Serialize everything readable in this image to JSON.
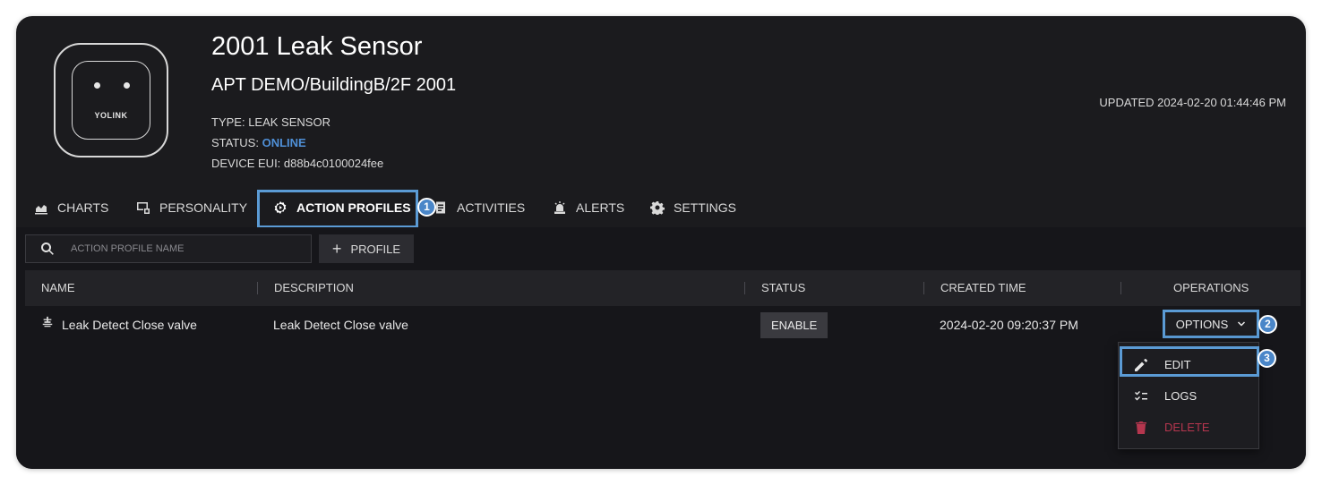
{
  "device": {
    "brand": "YOLINK",
    "title": "2001 Leak Sensor",
    "location": "APT DEMO/BuildingB/2F 2001",
    "type_label": "TYPE:",
    "type_value": "LEAK SENSOR",
    "status_label": "STATUS:",
    "status_value": "ONLINE",
    "eui_label": "DEVICE EUI:",
    "eui_value": "d88b4c0100024fee",
    "updated": "UPDATED 2024-02-20 01:44:46 PM"
  },
  "tabs": [
    {
      "label": "CHARTS",
      "icon": "chart-icon"
    },
    {
      "label": "PERSONALITY",
      "icon": "personality-icon"
    },
    {
      "label": "ACTION PROFILES",
      "icon": "action-profiles-icon",
      "active": true
    },
    {
      "label": "ACTIVITIES",
      "icon": "activities-icon"
    },
    {
      "label": "ALERTS",
      "icon": "alarm-icon"
    },
    {
      "label": "SETTINGS",
      "icon": "gear-icon"
    }
  ],
  "callouts": [
    "1",
    "2",
    "3"
  ],
  "search": {
    "placeholder": "ACTION PROFILE NAME"
  },
  "add_button": {
    "label": "PROFILE"
  },
  "table": {
    "headers": [
      "NAME",
      "DESCRIPTION",
      "STATUS",
      "CREATED TIME",
      "OPERATIONS"
    ],
    "rows": [
      {
        "name": "Leak Detect Close valve",
        "description": "Leak Detect Close valve",
        "status": "ENABLE",
        "created": "2024-02-20 09:20:37 PM",
        "operations": "OPTIONS"
      }
    ]
  },
  "menu": {
    "items": [
      {
        "label": "EDIT",
        "icon": "pencil-icon"
      },
      {
        "label": "LOGS",
        "icon": "checklist-icon"
      },
      {
        "label": "DELETE",
        "icon": "trash-icon"
      }
    ]
  },
  "colors": {
    "background": "#1b1b1e",
    "accent_online": "#4f8fd6",
    "highlight": "#5b9bd5",
    "danger": "#b5364e"
  }
}
